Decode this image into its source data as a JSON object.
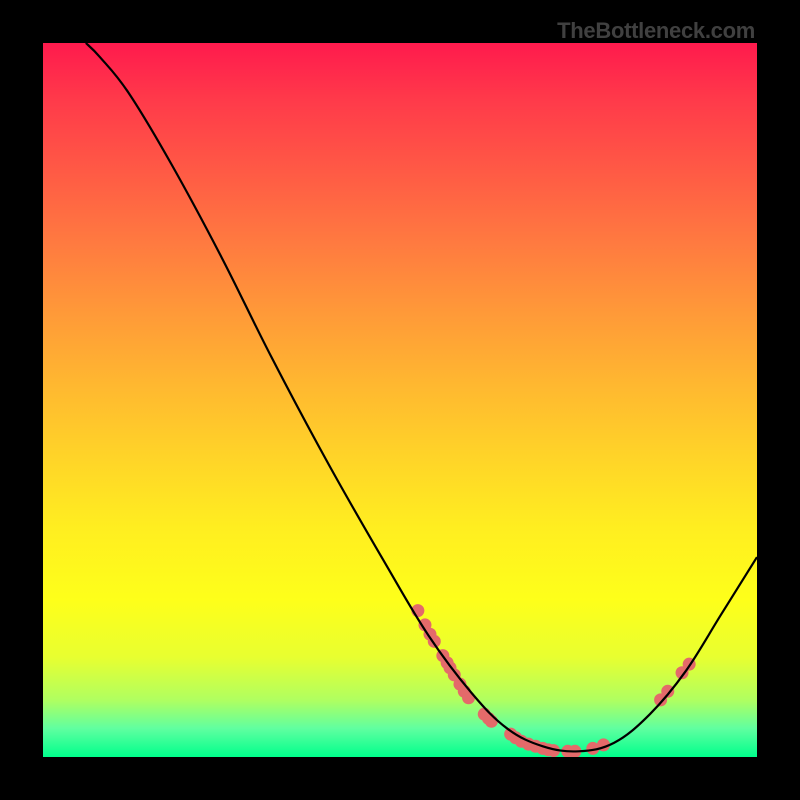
{
  "watermark": "TheBottleneck.com",
  "chart_data": {
    "type": "line",
    "title": "",
    "xlabel": "",
    "ylabel": "",
    "xlim": [
      0,
      100
    ],
    "ylim": [
      0,
      100
    ],
    "curve": [
      {
        "x": 6,
        "y": 100
      },
      {
        "x": 8,
        "y": 98
      },
      {
        "x": 12,
        "y": 93
      },
      {
        "x": 18,
        "y": 83
      },
      {
        "x": 25,
        "y": 70
      },
      {
        "x": 32,
        "y": 56
      },
      {
        "x": 40,
        "y": 41
      },
      {
        "x": 48,
        "y": 27
      },
      {
        "x": 54,
        "y": 17
      },
      {
        "x": 60,
        "y": 9
      },
      {
        "x": 65,
        "y": 4
      },
      {
        "x": 70,
        "y": 1.5
      },
      {
        "x": 75,
        "y": 0.8
      },
      {
        "x": 80,
        "y": 2
      },
      {
        "x": 85,
        "y": 6
      },
      {
        "x": 90,
        "y": 12
      },
      {
        "x": 95,
        "y": 20
      },
      {
        "x": 100,
        "y": 28
      }
    ],
    "scatter": [
      {
        "x": 52.5,
        "y": 20.5
      },
      {
        "x": 53.5,
        "y": 18.5
      },
      {
        "x": 54.2,
        "y": 17.2
      },
      {
        "x": 54.8,
        "y": 16.2
      },
      {
        "x": 56.0,
        "y": 14.2
      },
      {
        "x": 56.6,
        "y": 13.2
      },
      {
        "x": 57.0,
        "y": 12.5
      },
      {
        "x": 57.6,
        "y": 11.5
      },
      {
        "x": 58.4,
        "y": 10.2
      },
      {
        "x": 59.0,
        "y": 9.2
      },
      {
        "x": 59.6,
        "y": 8.3
      },
      {
        "x": 61.8,
        "y": 6.0
      },
      {
        "x": 62.4,
        "y": 5.4
      },
      {
        "x": 62.8,
        "y": 5.0
      },
      {
        "x": 65.5,
        "y": 3.2
      },
      {
        "x": 66.2,
        "y": 2.7
      },
      {
        "x": 67.0,
        "y": 2.2
      },
      {
        "x": 68.0,
        "y": 1.8
      },
      {
        "x": 69.0,
        "y": 1.5
      },
      {
        "x": 70.0,
        "y": 1.2
      },
      {
        "x": 70.8,
        "y": 1.0
      },
      {
        "x": 71.5,
        "y": 0.9
      },
      {
        "x": 73.5,
        "y": 0.8
      },
      {
        "x": 74.5,
        "y": 0.8
      },
      {
        "x": 77.0,
        "y": 1.2
      },
      {
        "x": 78.5,
        "y": 1.7
      },
      {
        "x": 86.5,
        "y": 8.0
      },
      {
        "x": 87.5,
        "y": 9.2
      },
      {
        "x": 89.5,
        "y": 11.8
      },
      {
        "x": 90.5,
        "y": 13.0
      }
    ],
    "colors": {
      "curve_stroke": "#000000",
      "scatter_fill": "#e46a6a",
      "background_top": "#ff1a4d",
      "background_bottom": "#00ff8c"
    }
  }
}
